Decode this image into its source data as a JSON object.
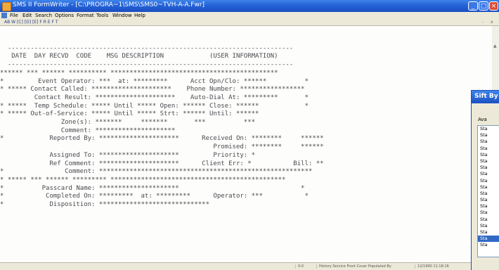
{
  "window": {
    "title": "SMS II FormWriter - [C:\\PROGRA~1\\SMS\\SMS0~TVH-A-A.Fwr]",
    "min_glyph": "_",
    "max_glyph": "□",
    "close_glyph": "×"
  },
  "menu": {
    "items": [
      "File",
      "Edit",
      "Search",
      "Options",
      "Format",
      "Tools",
      "Window",
      "Help"
    ]
  },
  "toolbar": {
    "text": "AB W  [C] [D] [E]  F  R  E  F  T",
    "mdi_min": "-",
    "mdi_close": "x"
  },
  "form": {
    "lines": [
      "",
      "  ---------------------------------------------------------------------------",
      "   DATE  DAY RECVD  CODE    MSG DESCRIPTION            (USER INFORMATION)",
      "  ---------------------------------------------------------------------------",
      "****** *** ****** ********** ********************************************",
      "*         Event Operator: ***  at: *********      Acct Opn/Clo: ******          *",
      "* ***** Contact Called: *********************    Phone Number: *****************",
      "         Contact Result: *********************    Auto-Dial At: *********       *",
      "* *****  Temp Schedule: ***** Until ***** Open: ****** Close: ******            *",
      "* ***** Out-of-Service: ***** Until ***** Strt: ****** Until: ******",
      "                Zone(s): *******     *******       ***          ***",
      "                Comment: *********************",
      "*            Reported By: *********************      Received On: ********     ******",
      "                                                        Promised: ********     ******",
      "             Assigned To: *********************         Priority: *",
      "             Ref Comment: *********************      Client Err: *           Bill: **",
      "*                Comment: ********************************************************",
      "* ***** *** ****** ********* **********************************************",
      "*          Passcard Name: *********************                                *",
      "*           Completed On: *********  at: *********      Operator: ***           *",
      "*            Disposition: *****************************"
    ]
  },
  "status": {
    "segments": [
      "0:0",
      "History Service Front Cover Populated By",
      "12/1990 11:18:16"
    ]
  },
  "dialog": {
    "title": "Sift By",
    "label": "Ava",
    "items": [
      "Sta",
      "Sta",
      "Sta",
      "Sta",
      "Sta",
      "Sta",
      "Sta",
      "Sta",
      "Sta",
      "Sta",
      "Sta",
      "Sta",
      "Sta",
      "Sta",
      "Sta",
      "Sta",
      "Sta",
      "Sta",
      "Sta"
    ],
    "selected_index": 17
  }
}
